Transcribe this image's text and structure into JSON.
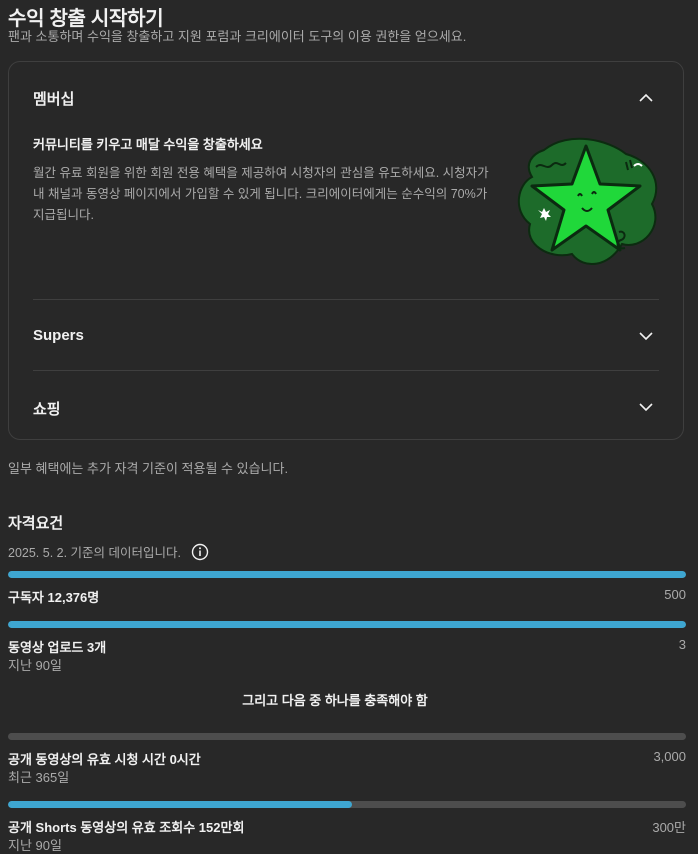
{
  "header": {
    "title": "수익 창출 시작하기",
    "subtitle": "팬과 소통하며 수익을 창출하고 지원 포럼과 크리에이터 도구의 이용 권한을 얻으세요."
  },
  "benefits": {
    "membership": {
      "title": "멤버십",
      "expanded": true,
      "headline": "커뮤니티를 키우고 매달 수익을 창출하세요",
      "description": "월간 유료 회원을 위한 회원 전용 혜택을 제공하여 시청자의 관심을 유도하세요. 시청자가 내 채널과 동영상 페이지에서 가입할 수 있게 됩니다. 크리에이터에게는 순수익의 70%가 지급됩니다.",
      "illustration": "green-star-illustration"
    },
    "supers": {
      "title": "Supers",
      "expanded": false
    },
    "shopping": {
      "title": "쇼핑",
      "expanded": false
    },
    "note": "일부 혜택에는 추가 자격 기준이 적용될 수 있습니다."
  },
  "eligibility": {
    "title": "자격요건",
    "date_note": "2025. 5. 2. 기준의 데이터입니다.",
    "info_icon": "info-icon",
    "or_text": "그리고 다음 중 하나를 충족해야 함",
    "requirements": [
      {
        "label": "구독자 12,376명",
        "target": "500",
        "sub": "",
        "progress": 1.0
      },
      {
        "label": "동영상 업로드 3개",
        "target": "3",
        "sub": "지난 90일",
        "progress": 1.0
      },
      {
        "label": "공개 동영상의 유효 시청 시간 0시간",
        "target": "3,000",
        "sub": "최근 365일",
        "progress": 0.0
      },
      {
        "label": "공개 Shorts 동영상의 유효 조회수 152만회",
        "target": "300만",
        "sub": "지난 90일",
        "progress": 0.5067
      }
    ]
  },
  "colors": {
    "progress_fill": "#3ea6d1",
    "progress_track": "#4d4d4d",
    "background": "#282828"
  }
}
